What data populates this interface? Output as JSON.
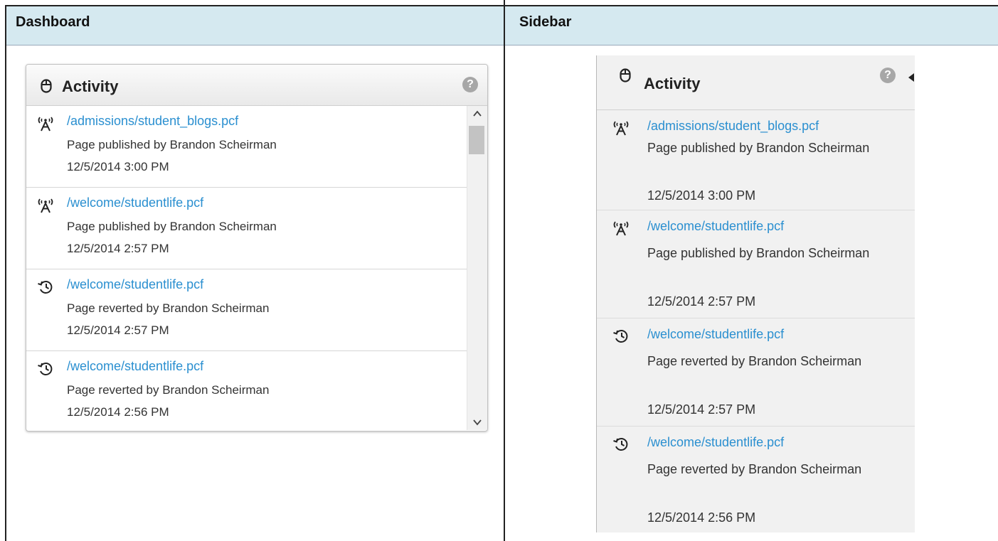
{
  "columns": {
    "left_heading": "Dashboard",
    "right_heading": "Sidebar"
  },
  "widget": {
    "title": "Activity",
    "help_glyph": "?",
    "items": [
      {
        "icon": "publish-icon",
        "path": "/admissions/student_blogs.pcf",
        "action": "Page published by Brandon Scheirman",
        "time": "12/5/2014 3:00 PM"
      },
      {
        "icon": "publish-icon",
        "path": "/welcome/studentlife.pcf",
        "action": "Page published by Brandon Scheirman",
        "time": "12/5/2014 2:57 PM"
      },
      {
        "icon": "revert-icon",
        "path": "/welcome/studentlife.pcf",
        "action": "Page reverted by Brandon Scheirman",
        "time": "12/5/2014 2:57 PM"
      },
      {
        "icon": "revert-icon",
        "path": "/welcome/studentlife.pcf",
        "action": "Page reverted by Brandon Scheirman",
        "time": "12/5/2014 2:56 PM"
      }
    ]
  },
  "sidebar": {
    "title": "Activity",
    "help_glyph": "?",
    "items": [
      {
        "icon": "publish-icon",
        "path": "/admissions/student_blogs.pcf",
        "action": "Page published by Brandon Scheirman",
        "time": "12/5/2014 3:00 PM"
      },
      {
        "icon": "publish-icon",
        "path": "/welcome/studentlife.pcf",
        "action": "Page published by Brandon Scheirman",
        "time": "12/5/2014 2:57 PM"
      },
      {
        "icon": "revert-icon",
        "path": "/welcome/studentlife.pcf",
        "action": "Page reverted by Brandon Scheirman",
        "time": "12/5/2014 2:57 PM"
      },
      {
        "icon": "revert-icon",
        "path": "/welcome/studentlife.pcf",
        "action": "Page reverted by Brandon Scheirman",
        "time": "12/5/2014 2:56 PM"
      }
    ]
  },
  "colors": {
    "header_bg": "#d5e9f0",
    "link": "#2a8fd0",
    "panel_bg": "#f1f1f1"
  }
}
